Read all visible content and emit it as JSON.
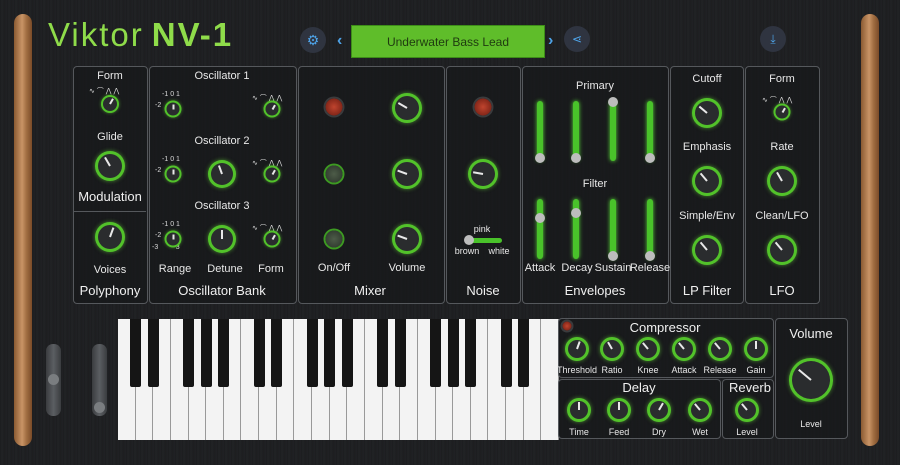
{
  "header": {
    "brand": "Viktor",
    "model": "NV-1",
    "preset_name": "Underwater Bass Lead",
    "settings_icon": "gear-icon",
    "prev_icon": "chevron-left-icon",
    "next_icon": "chevron-right-icon",
    "share_icon": "share-icon",
    "download_icon": "download-icon"
  },
  "modulation": {
    "form_label": "Form",
    "glide_label": "Glide",
    "title": "Modulation"
  },
  "polyphony": {
    "voices_label": "Voices",
    "title": "Polyphony"
  },
  "oscillator_bank": {
    "title": "Oscillator Bank",
    "oscillators": [
      "Oscillator 1",
      "Oscillator 2",
      "Oscillator 3"
    ],
    "range_ticks": [
      "-1",
      "0",
      "1",
      "-2",
      "2",
      "-3",
      "3"
    ],
    "range_label": "Range",
    "detune_label": "Detune",
    "form_label": "Form"
  },
  "mixer": {
    "title": "Mixer",
    "onoff_label": "On/Off",
    "volume_label": "Volume"
  },
  "noise": {
    "title": "Noise",
    "pink_label": "pink",
    "brown_label": "brown",
    "white_label": "white"
  },
  "envelopes": {
    "title": "Envelopes",
    "primary_label": "Primary",
    "filter_label": "Filter",
    "params": [
      "Attack",
      "Decay",
      "Sustain",
      "Release"
    ]
  },
  "lp_filter": {
    "title": "LP Filter",
    "cutoff_label": "Cutoff",
    "emphasis_label": "Emphasis",
    "env_label": "Simple/Env"
  },
  "lfo": {
    "title": "LFO",
    "form_label": "Form",
    "rate_label": "Rate",
    "clean_label": "Clean/LFO"
  },
  "compressor": {
    "title": "Compressor",
    "params": [
      "Threshold",
      "Ratio",
      "Knee",
      "Attack",
      "Release",
      "Gain"
    ]
  },
  "delay": {
    "title": "Delay",
    "params": [
      "Time",
      "Feed",
      "Dry",
      "Wet"
    ]
  },
  "reverb": {
    "title": "Reverb",
    "level_label": "Level"
  },
  "volume": {
    "title": "Volume",
    "level_label": "Level"
  },
  "colors": {
    "accent_green": "#52c22a",
    "preset_bg": "#5fbd2a",
    "title_green": "#8fdc4a",
    "button_blue": "#4ea3e8"
  }
}
